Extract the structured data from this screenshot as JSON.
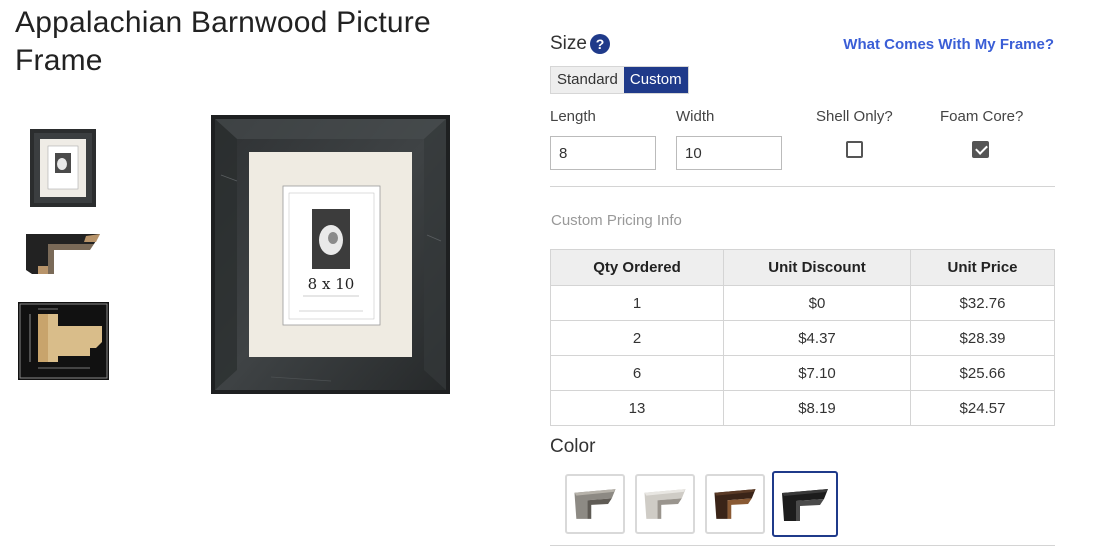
{
  "product": {
    "title": "Appalachian Barnwood Picture Frame",
    "thumbnails": [
      "framed-photo-thumbnail",
      "frame-corner-thumbnail",
      "frame-profile-diagram-thumbnail"
    ],
    "main_image": {
      "mat_text": "8 x 10"
    }
  },
  "size": {
    "label": "Size",
    "help_icon": "?",
    "link_text": "What Comes With My Frame?",
    "toggle": {
      "standard": "Standard",
      "custom": "Custom",
      "selected": "Custom"
    },
    "length": {
      "label": "Length",
      "value": "8"
    },
    "width": {
      "label": "Width",
      "value": "10"
    },
    "shell_only": {
      "label": "Shell Only?",
      "checked": false
    },
    "foam_core": {
      "label": "Foam Core?",
      "checked": true
    }
  },
  "pricing": {
    "label": "Custom Pricing Info",
    "headers": [
      "Qty Ordered",
      "Unit Discount",
      "Unit Price"
    ],
    "rows": [
      [
        "1",
        "$0",
        "$32.76"
      ],
      [
        "2",
        "$4.37",
        "$28.39"
      ],
      [
        "6",
        "$7.10",
        "$25.66"
      ],
      [
        "13",
        "$8.19",
        "$24.57"
      ]
    ]
  },
  "color": {
    "label": "Color",
    "swatches": [
      "gray",
      "white",
      "brown",
      "black"
    ],
    "selected": "black"
  },
  "colors": {
    "accent": "#1f3a8a",
    "link": "#3a5ed6"
  }
}
